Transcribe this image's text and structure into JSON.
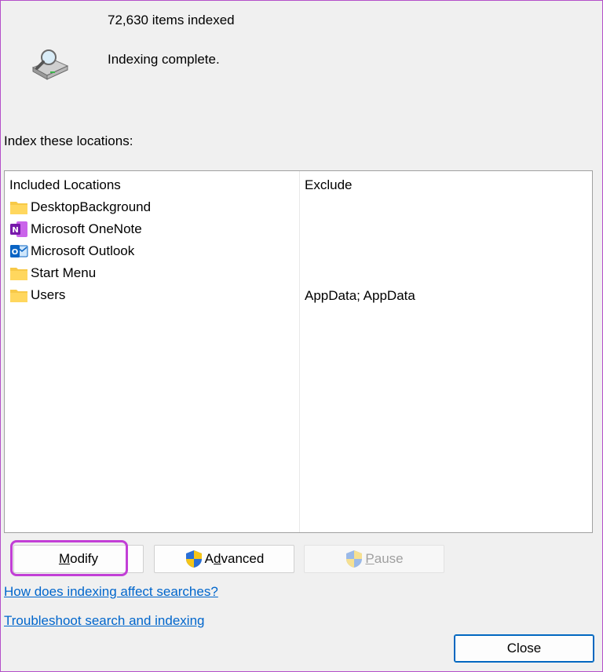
{
  "status": {
    "count_text": "72,630 items indexed",
    "message": "Indexing complete."
  },
  "section_label": "Index these locations:",
  "list": {
    "col_included": "Included Locations",
    "col_exclude": "Exclude",
    "rows": [
      {
        "name": "DesktopBackground",
        "icon": "folder-icon",
        "exclude": ""
      },
      {
        "name": "Microsoft OneNote",
        "icon": "onenote-icon",
        "exclude": ""
      },
      {
        "name": "Microsoft Outlook",
        "icon": "outlook-icon",
        "exclude": ""
      },
      {
        "name": "Start Menu",
        "icon": "folder-icon",
        "exclude": ""
      },
      {
        "name": "Users",
        "icon": "folder-icon",
        "exclude": "AppData; AppData"
      }
    ]
  },
  "buttons": {
    "modify_accel": "M",
    "modify_rest": "odify",
    "advanced_pre": "A",
    "advanced_accel": "d",
    "advanced_rest": "vanced",
    "pause_accel": "P",
    "pause_rest": "ause",
    "close": "Close"
  },
  "links": {
    "how": "How does indexing affect searches?",
    "troubleshoot": "Troubleshoot search and indexing"
  },
  "colors": {
    "accent": "#0067c0",
    "highlight": "#c23fd6",
    "link": "#0066cc"
  }
}
